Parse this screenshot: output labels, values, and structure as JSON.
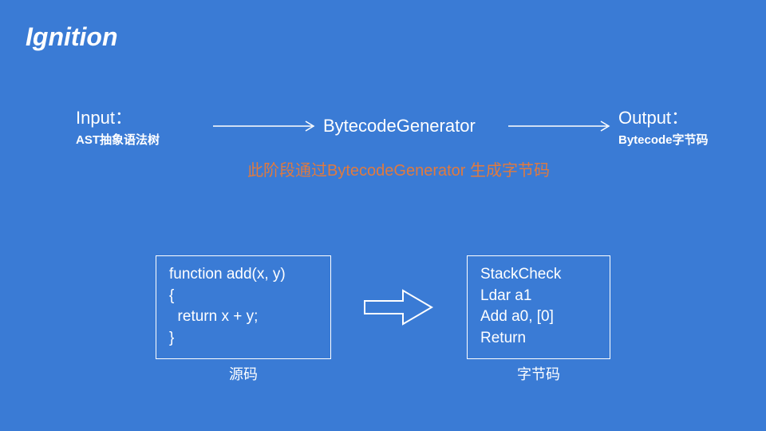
{
  "title": "Ignition",
  "flow": {
    "input": {
      "main": "Input：",
      "sub": "AST抽象语法树"
    },
    "center": "BytecodeGenerator",
    "output": {
      "main": "Output：",
      "sub": "Bytecode字节码"
    }
  },
  "annotation": "此阶段通过BytecodeGenerator\n生成字节码",
  "codeLeft": "function add(x, y)\n{\n  return x + y;\n}",
  "codeRight": "StackCheck\nLdar a1\nAdd a0, [0]\nReturn",
  "captionLeft": "源码",
  "captionRight": "字节码",
  "colors": {
    "bg": "#3a7bd5",
    "accent": "#e07a3f",
    "fg": "#ffffff"
  }
}
